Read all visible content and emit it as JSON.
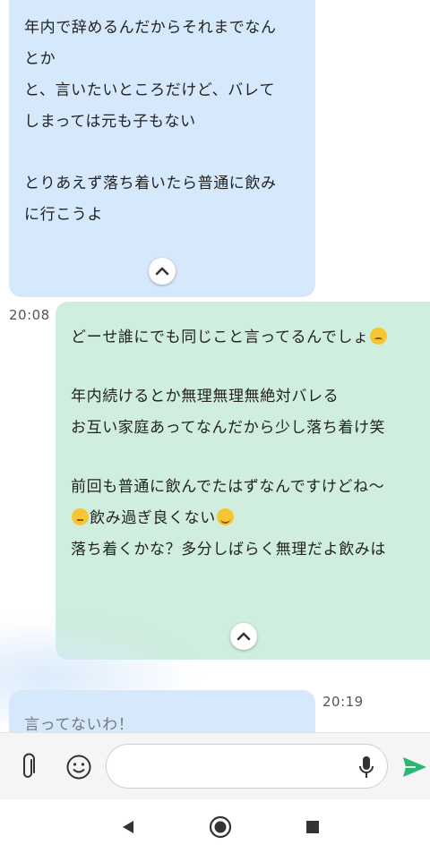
{
  "messages": [
    {
      "direction": "incoming",
      "lines": [
        "年内で辞めるんだからそれまでなん",
        "とか",
        "と、言いたいところだけど、バレて",
        "しまっては元も子もない",
        "",
        "とりあえず落ち着いたら普通に飲み",
        "に行こうよ"
      ]
    },
    {
      "direction": "outgoing",
      "time": "20:08",
      "lines": {
        "l1": "どーせ誰にでも同じこと言ってるんでしょ",
        "l2": "年内続けるとか無理無理無絶対バレる",
        "l3": "お互い家庭あってなんだから少し落ち着け笑",
        "l4": "前回も普通に飲んでたはずなんですけどね〜",
        "l5": "飲み過ぎ良くない",
        "l6": "落ち着くかな？多分しばらく無理だよ飲みは"
      },
      "emojis": {
        "e1": "disappointed-face",
        "e2": "thinking-face",
        "e3": "grinning-sweat-face"
      }
    },
    {
      "direction": "incoming",
      "time": "20:19",
      "lines": [
        "言ってないわ！"
      ]
    }
  ],
  "input": {
    "placeholder": ""
  },
  "icons": {
    "attach": "paperclip-icon",
    "emoji": "smiley-icon",
    "mic": "microphone-icon",
    "send": "send-icon",
    "collapse": "chevron-up-icon",
    "nav_back": "back-triangle-icon",
    "nav_home": "home-circle-icon",
    "nav_recent": "recent-square-icon"
  },
  "colors": {
    "incoming_bubble": "#d6e8fb",
    "outgoing_bubble": "#cfeedd",
    "send_accent": "#2bb673"
  }
}
